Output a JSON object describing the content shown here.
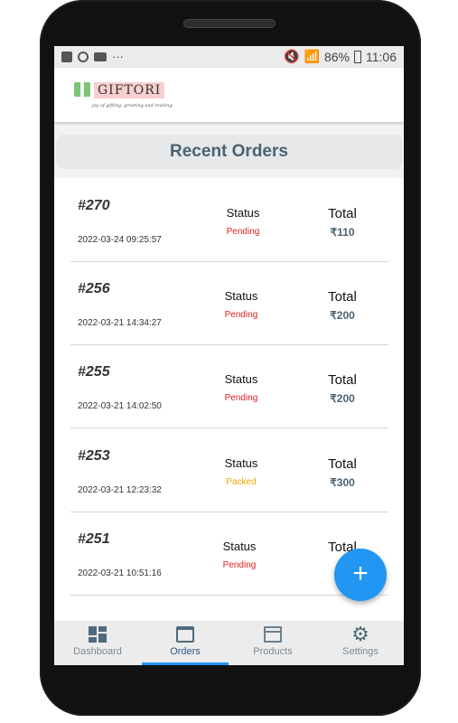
{
  "status_bar": {
    "battery": "86%",
    "time": "11:06"
  },
  "brand": {
    "logo_text": "GIFTORI",
    "tagline": "joy of gifting, greeting and inviting"
  },
  "page_title": "Recent Orders",
  "column_labels": {
    "status": "Status",
    "total": "Total"
  },
  "orders": [
    {
      "id": "#270",
      "date": "2022-03-24 09:25:57",
      "status": "Pending",
      "total": "₹110"
    },
    {
      "id": "#256",
      "date": "2022-03-21 14:34:27",
      "status": "Pending",
      "total": "₹200"
    },
    {
      "id": "#255",
      "date": "2022-03-21 14:02:50",
      "status": "Pending",
      "total": "₹200"
    },
    {
      "id": "#253",
      "date": "2022-03-21 12:23:32",
      "status": "Packed",
      "total": "₹300"
    },
    {
      "id": "#251",
      "date": "2022-03-21 10:51:16",
      "status": "Pending",
      "total": "₹"
    }
  ],
  "fab_icon": "plus-icon",
  "nav": [
    {
      "label": "Dashboard",
      "icon": "dashboard-icon"
    },
    {
      "label": "Orders",
      "icon": "store-icon",
      "active": true
    },
    {
      "label": "Products",
      "icon": "archive-box-icon"
    },
    {
      "label": "Settings",
      "icon": "gear-icon"
    }
  ],
  "colors": {
    "pending": "#e02020",
    "packed": "#f0a800",
    "accent": "#2196f3",
    "title": "#4a6272"
  }
}
